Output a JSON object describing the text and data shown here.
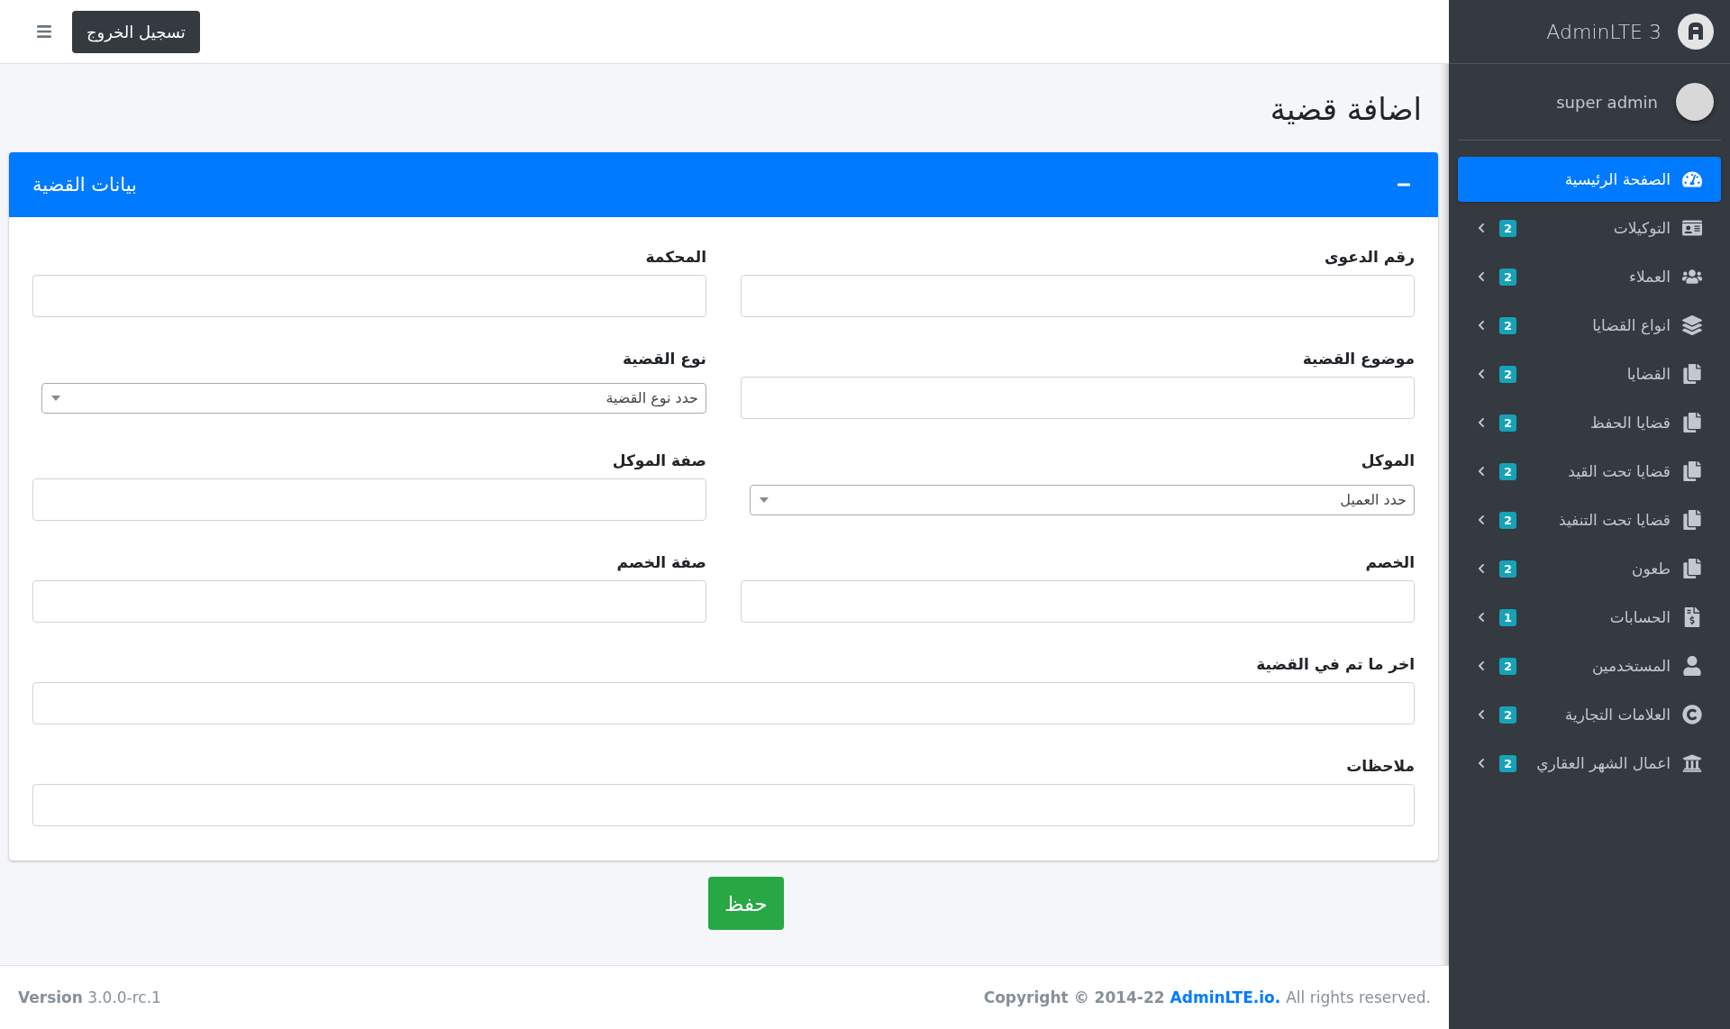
{
  "navbar": {
    "logout_button": "تسجيل الخروج"
  },
  "sidebar": {
    "brand": "AdminLTE 3",
    "user": "super admin",
    "items": [
      {
        "label": "الصفحة الرئيسية",
        "selected": true
      },
      {
        "label": "التوكيلات",
        "badge": "2",
        "selected": false
      },
      {
        "label": "العملاء",
        "badge": "2",
        "selected": false
      },
      {
        "label": "انواع القضايا",
        "badge": "2",
        "selected": false
      },
      {
        "label": "القضايا",
        "badge": "2",
        "selected": false
      },
      {
        "label": "قضايا الحفظ",
        "badge": "2",
        "selected": false
      },
      {
        "label": "قضايا تحت القيد",
        "badge": "2",
        "selected": false
      },
      {
        "label": "قضايا تحت التنفيذ",
        "badge": "2",
        "selected": false
      },
      {
        "label": "طعون",
        "badge": "2",
        "selected": false
      },
      {
        "label": "الحسابات",
        "badge": "1",
        "selected": false
      },
      {
        "label": "المستخدمين",
        "badge": "2",
        "selected": false
      },
      {
        "label": "العلامات التجارية",
        "badge": "2",
        "selected": false
      },
      {
        "label": "اعمال الشهر العقاري",
        "badge": "2",
        "selected": false
      }
    ]
  },
  "page_title": "اضافة قضية",
  "card": {
    "title": "بيانات القضية",
    "fields": [
      {
        "label": "رقم الدعوى",
        "kind": "input",
        "full_width": false
      },
      {
        "label": "المحكمة",
        "kind": "input",
        "full_width": false
      },
      {
        "label": "موضوع القضية",
        "kind": "input",
        "full_width": false
      },
      {
        "label": "نوع القضية",
        "kind": "select",
        "placeholder": "حدد نوع القضية",
        "full_width": false
      },
      {
        "label": "الموكل",
        "kind": "select",
        "placeholder": "حدد العميل",
        "full_width": false
      },
      {
        "label": "صفة الموكل",
        "kind": "input",
        "full_width": false
      },
      {
        "label": "الخصم",
        "kind": "input",
        "full_width": false
      },
      {
        "label": "صفة الخصم",
        "kind": "input",
        "full_width": false
      },
      {
        "label": "اخر ما تم في القضية",
        "kind": "input",
        "full_width": true
      },
      {
        "label": "ملاحظات",
        "kind": "input",
        "full_width": true
      }
    ]
  },
  "save_button": "حفظ",
  "footer": {
    "copyright": "Copyright © 2014-22",
    "link": "AdminLTE.io.",
    "rights": "All rights reserved.",
    "version_label": "Version",
    "version": "3.0.0-rc.1"
  }
}
